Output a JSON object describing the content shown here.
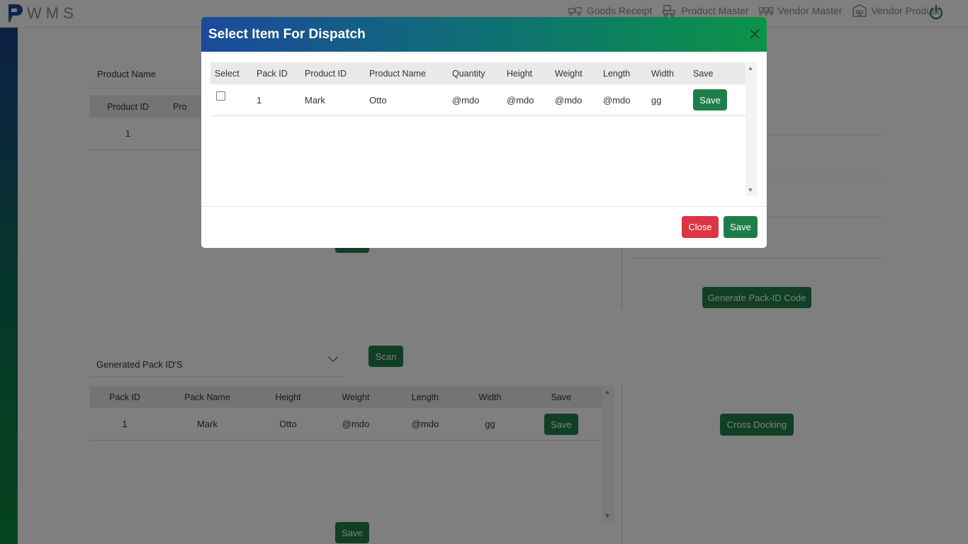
{
  "app": {
    "logo_text": "WMS"
  },
  "nav": {
    "items": [
      {
        "label": "Goods Receipt",
        "icon": "forklift-icon"
      },
      {
        "label": "Product Master",
        "icon": "truck-icon"
      },
      {
        "label": "Vendor Master",
        "icon": "conveyor-icon"
      },
      {
        "label": "Vendor Product",
        "icon": "warehouse-icon"
      }
    ],
    "power_icon": "power-icon"
  },
  "product_section": {
    "label": "Product Name",
    "table": {
      "headers": [
        "Product ID",
        "Pro"
      ],
      "rows": [
        [
          "1"
        ]
      ]
    }
  },
  "right_panel": {
    "generate_label": "Generate Pack-ID Code",
    "cross_docking_label": "Cross Docking"
  },
  "pack_section": {
    "select_label": "Generated Pack ID'S",
    "scan_label": "Scan",
    "table": {
      "headers": [
        "Pack ID",
        "Pack Name",
        "Height",
        "Weight",
        "Length",
        "Width",
        "Save"
      ],
      "rows": [
        {
          "pack_id": "1",
          "pack_name": "Mark",
          "height": "Otto",
          "weight": "@mdo",
          "length": "@mdo",
          "width": "gg",
          "save": "Save"
        }
      ]
    },
    "save_label": "Save"
  },
  "modal": {
    "title": "Select Item For Dispatch",
    "headers": [
      "Select",
      "Pack ID",
      "Product ID",
      "Product Name",
      "Quantity",
      "Height",
      "Weight",
      "Length",
      "Width",
      "Save"
    ],
    "rows": [
      {
        "pack_id": "1",
        "product_id": "Mark",
        "product_name": "Otto",
        "quantity": "@mdo",
        "height": "@mdo",
        "weight": "@mdo",
        "length": "@mdo",
        "width": "gg",
        "save": "Save"
      }
    ],
    "close_label": "Close",
    "save_label": "Save"
  },
  "colors": {
    "primary_green": "#1e7e4a",
    "danger_red": "#dc3545",
    "header_gradient_start": "#1b4a9c",
    "header_gradient_end": "#0b9448"
  }
}
